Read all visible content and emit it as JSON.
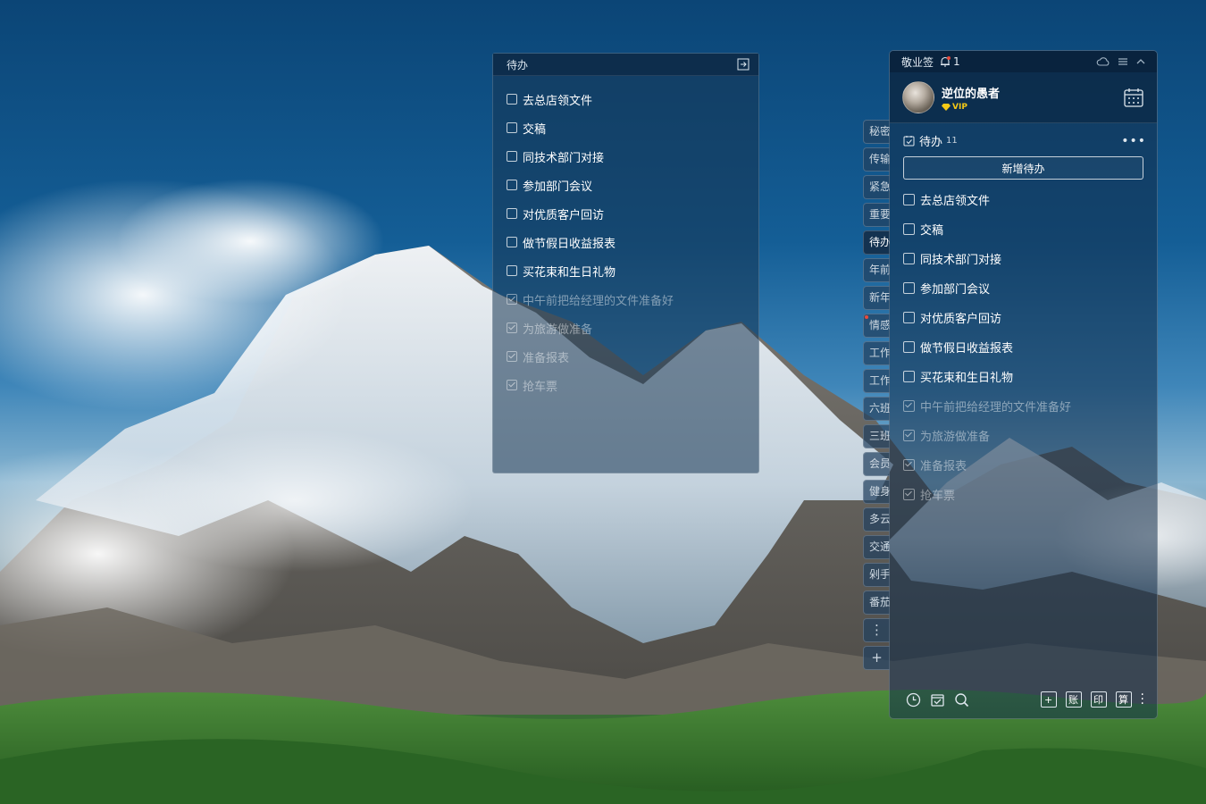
{
  "float_panel": {
    "title": "待办",
    "items": [
      {
        "text": "去总店领文件",
        "done": false
      },
      {
        "text": "交稿",
        "done": false
      },
      {
        "text": "同技术部门对接",
        "done": false
      },
      {
        "text": "参加部门会议",
        "done": false
      },
      {
        "text": "对优质客户回访",
        "done": false
      },
      {
        "text": "做节假日收益报表",
        "done": false
      },
      {
        "text": "买花束和生日礼物",
        "done": false
      },
      {
        "text": "中午前把给经理的文件准备好",
        "done": true
      },
      {
        "text": "为旅游做准备",
        "done": true
      },
      {
        "text": "准备报表",
        "done": true
      },
      {
        "text": "抢车票",
        "done": true
      }
    ]
  },
  "side_tabs": [
    "秘密",
    "传输",
    "紧急",
    "重要",
    "待办",
    "年前",
    "新年",
    "情感",
    "工作",
    "工作",
    "六班",
    "三班",
    "会员",
    "健身",
    "多云",
    "交通",
    "剁手",
    "番茄"
  ],
  "side_tab_active": "待办",
  "main_panel": {
    "app_title": "敬业签",
    "notification_count": "1",
    "username": "逆位的愚者",
    "vip_label": "VIP",
    "todo_label": "待办",
    "todo_count": "11",
    "add_button_label": "新增待办",
    "items": [
      {
        "text": "去总店领文件",
        "done": false
      },
      {
        "text": "交稿",
        "done": false
      },
      {
        "text": "同技术部门对接",
        "done": false
      },
      {
        "text": "参加部门会议",
        "done": false
      },
      {
        "text": "对优质客户回访",
        "done": false
      },
      {
        "text": "做节假日收益报表",
        "done": false
      },
      {
        "text": "买花束和生日礼物",
        "done": false
      },
      {
        "text": "中午前把给经理的文件准备好",
        "done": true
      },
      {
        "text": "为旅游做准备",
        "done": true
      },
      {
        "text": "准备报表",
        "done": true
      },
      {
        "text": "抢车票",
        "done": true
      }
    ],
    "bottom_buttons": {
      "add": "+",
      "ledger": "账",
      "print": "印",
      "calc": "算"
    }
  },
  "colors": {
    "vip": "#f5c916",
    "accent_dot": "#e84a3c"
  }
}
